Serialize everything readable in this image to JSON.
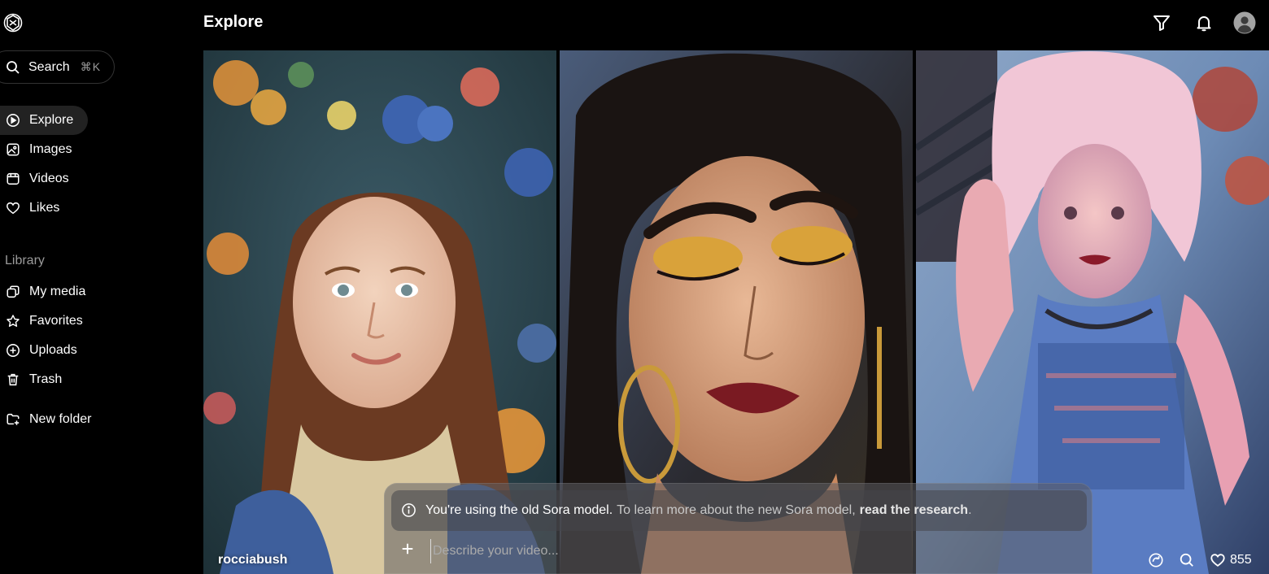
{
  "header": {
    "title": "Explore"
  },
  "search": {
    "label": "Search",
    "shortcut": "⌘K"
  },
  "nav": {
    "explore": "Explore",
    "images": "Images",
    "videos": "Videos",
    "likes": "Likes"
  },
  "library": {
    "heading": "Library",
    "my_media": "My media",
    "favorites": "Favorites",
    "uploads": "Uploads",
    "trash": "Trash",
    "new_folder": "New folder"
  },
  "feed": {
    "first_author": "rocciabush",
    "likes_count": "855"
  },
  "composer": {
    "notice_strong": "You're using the old Sora model.",
    "notice_muted": "To learn more about the new Sora model,",
    "notice_link": "read the research",
    "notice_end": ".",
    "placeholder": "Describe your video..."
  },
  "icons": {
    "logo": "openai-logo-icon",
    "filter": "filter-icon",
    "bell": "bell-icon",
    "avatar": "user-avatar-icon"
  },
  "colors": {
    "background": "#000000",
    "active_nav": "#222222",
    "muted_text": "#9a9a9a"
  }
}
